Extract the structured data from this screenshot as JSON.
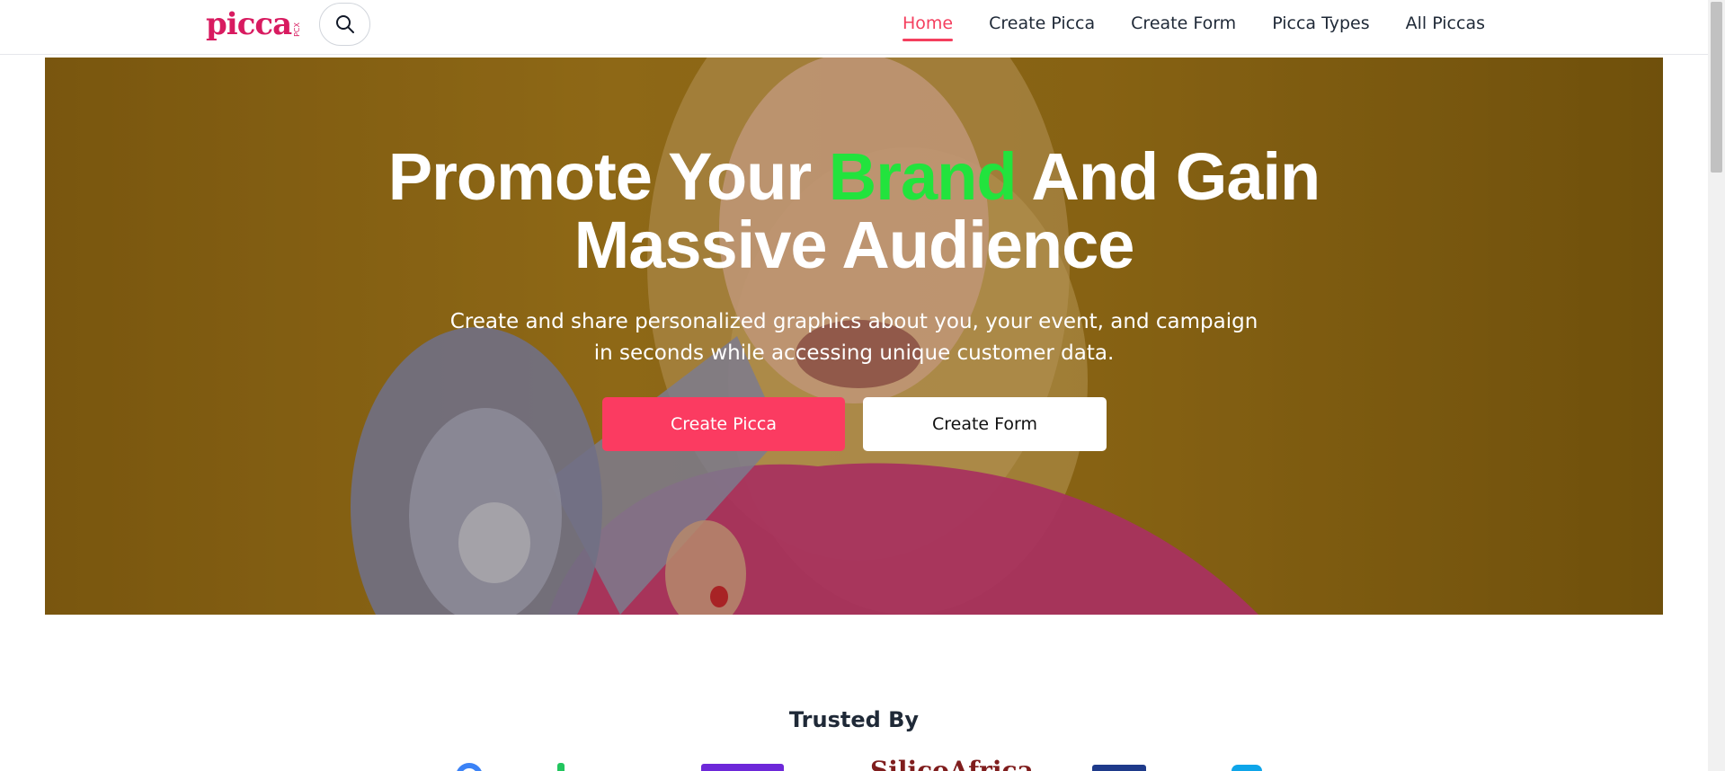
{
  "header": {
    "logo_text": "picca",
    "logo_suffix": "PCX",
    "search_icon": "search-icon",
    "nav": [
      {
        "label": "Home",
        "active": true
      },
      {
        "label": "Create Picca",
        "active": false
      },
      {
        "label": "Create Form",
        "active": false
      },
      {
        "label": "Picca Types",
        "active": false
      },
      {
        "label": "All Piccas",
        "active": false
      }
    ]
  },
  "hero": {
    "title_before": "Promote Your ",
    "title_accent": "Brand",
    "title_after": " And Gain",
    "title_line2": "Massive Audience",
    "subtitle": "Create and share personalized graphics about you, your event, and campaign in seconds while accessing unique customer data.",
    "primary_button": "Create Picca",
    "secondary_button": "Create Form",
    "image_description_icon": "woman-megaphone-photo"
  },
  "trusted": {
    "title": "Trusted By",
    "partner_fragment_text": "SilicoAfrica"
  },
  "colors": {
    "brand": "#d81b60",
    "accent_pink": "#fb3b61",
    "accent_green": "#22e33d",
    "nav_active": "#f43f5e"
  }
}
